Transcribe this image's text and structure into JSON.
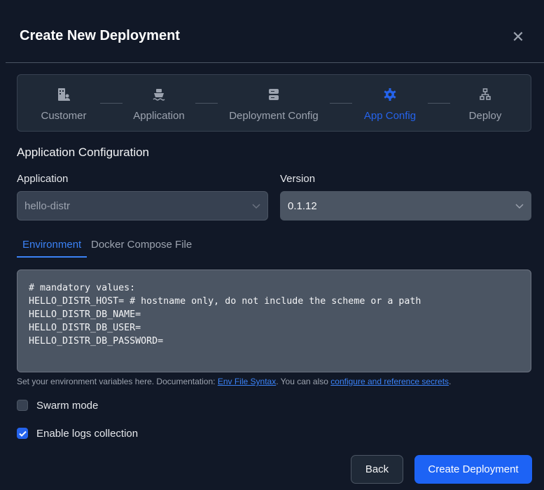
{
  "dialog": {
    "title": "Create New Deployment",
    "close_icon": "close-icon"
  },
  "stepper": {
    "steps": [
      {
        "label": "Customer",
        "icon": "building-user-icon",
        "active": false
      },
      {
        "label": "Application",
        "icon": "ship-icon",
        "active": false
      },
      {
        "label": "Deployment Config",
        "icon": "server-icon",
        "active": false
      },
      {
        "label": "App Config",
        "icon": "gear-icon",
        "active": true
      },
      {
        "label": "Deploy",
        "icon": "network-icon",
        "active": false
      }
    ],
    "active_color": "#2563eb"
  },
  "section": {
    "title": "Application Configuration"
  },
  "fields": {
    "application": {
      "label": "Application",
      "value": "hello-distr"
    },
    "version": {
      "label": "Version",
      "value": "0.1.12"
    }
  },
  "tabs": [
    {
      "label": "Environment",
      "active": true
    },
    {
      "label": "Docker Compose File",
      "active": false
    }
  ],
  "env_text": "# mandatory values:\nHELLO_DISTR_HOST= # hostname only, do not include the scheme or a path\nHELLO_DISTR_DB_NAME=\nHELLO_DISTR_DB_USER=\nHELLO_DISTR_DB_PASSWORD=",
  "help": {
    "prefix": "Set your environment variables here. Documentation: ",
    "link1": "Env File Syntax",
    "middle": ". You can also ",
    "link2": "configure and reference secrets",
    "suffix": "."
  },
  "options": {
    "swarm": {
      "label": "Swarm mode",
      "checked": false
    },
    "logs": {
      "label": "Enable logs collection",
      "checked": true
    }
  },
  "buttons": {
    "back": "Back",
    "create": "Create Deployment"
  }
}
